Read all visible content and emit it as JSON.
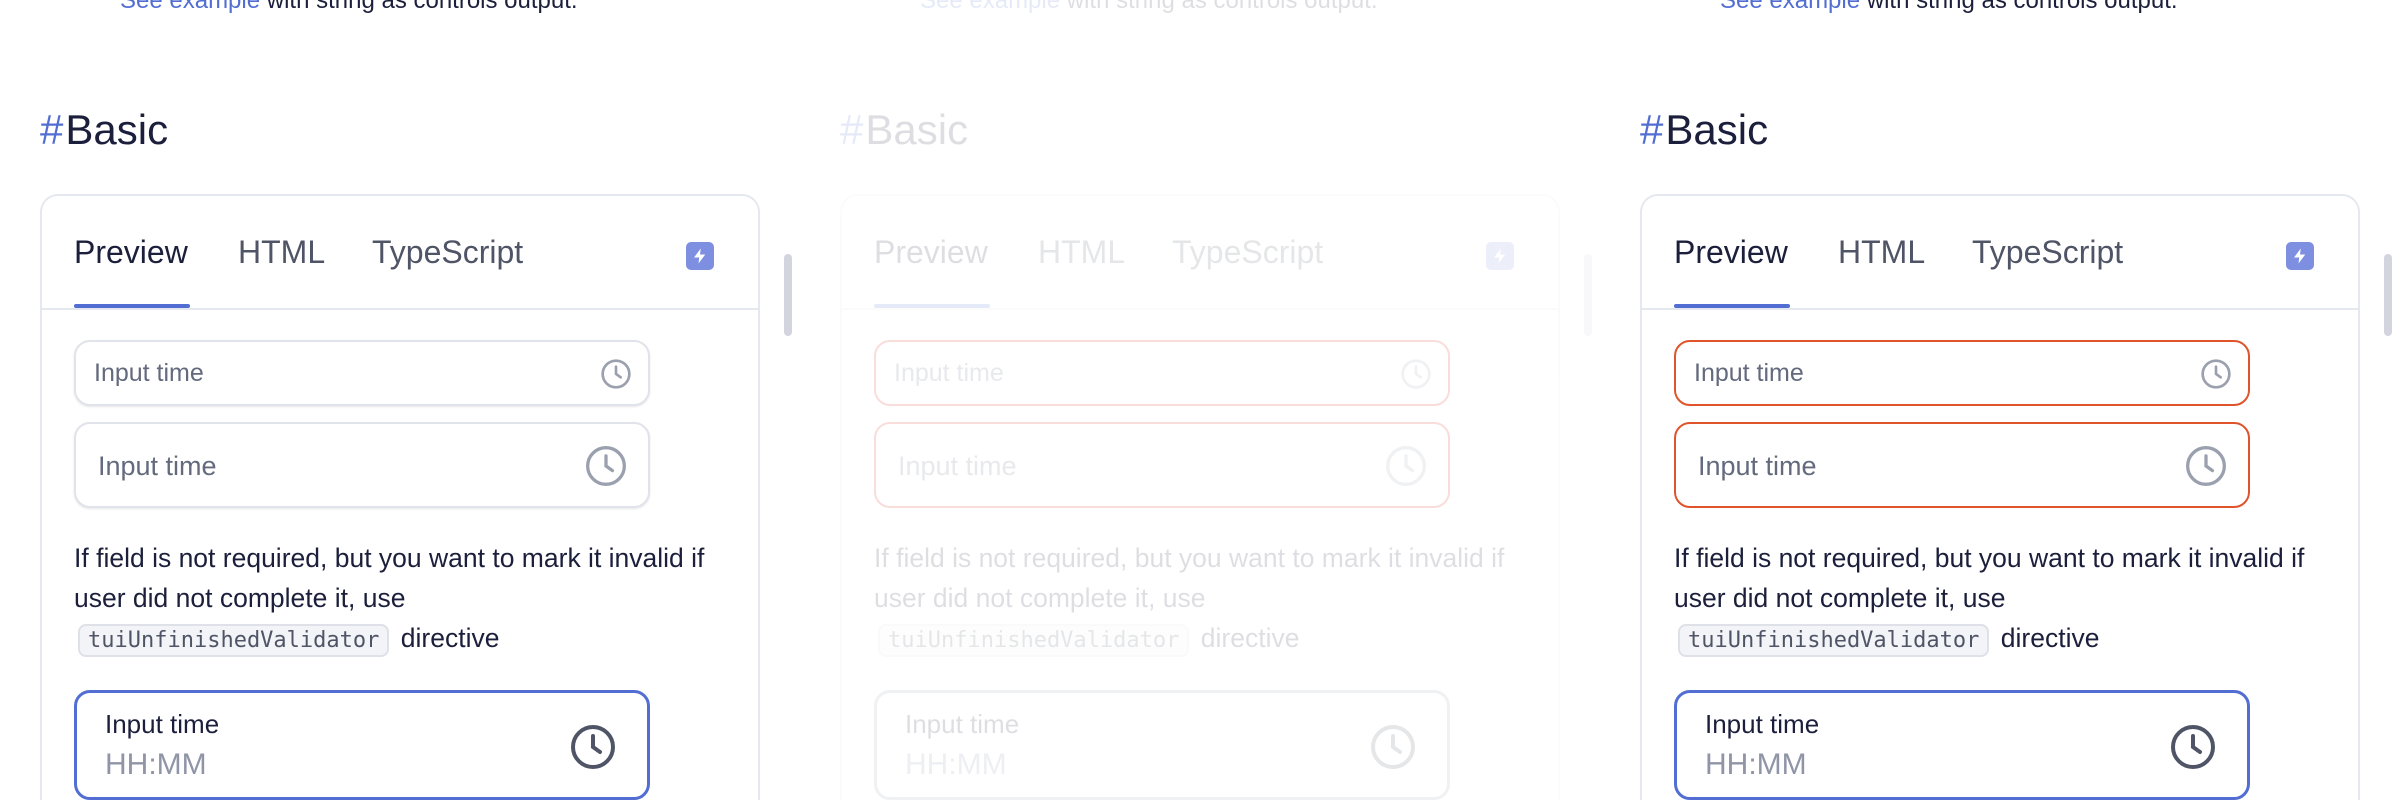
{
  "top_note": {
    "link": "See example",
    "text": " with string as controls output."
  },
  "section": {
    "hash": "#",
    "title": "Basic"
  },
  "tabs": [
    {
      "label": "Preview",
      "active": true
    },
    {
      "label": "HTML",
      "active": false
    },
    {
      "label": "TypeScript",
      "active": false
    }
  ],
  "fields": {
    "small_placeholder": "Input time",
    "medium_placeholder": "Input time",
    "large_label": "Input time",
    "large_placeholder": "HH:MM"
  },
  "hint": {
    "before": "If field is not required, but you want to mark it invalid if user did not complete it, use ",
    "code": "tuiUnfinishedValidator",
    "after": " directive"
  },
  "icons": {
    "tab_action": "bolt-icon",
    "field": "clock-icon"
  },
  "colors": {
    "accent": "#526ed3",
    "invalid": "#e0542b",
    "text": "#1b1f3b"
  }
}
